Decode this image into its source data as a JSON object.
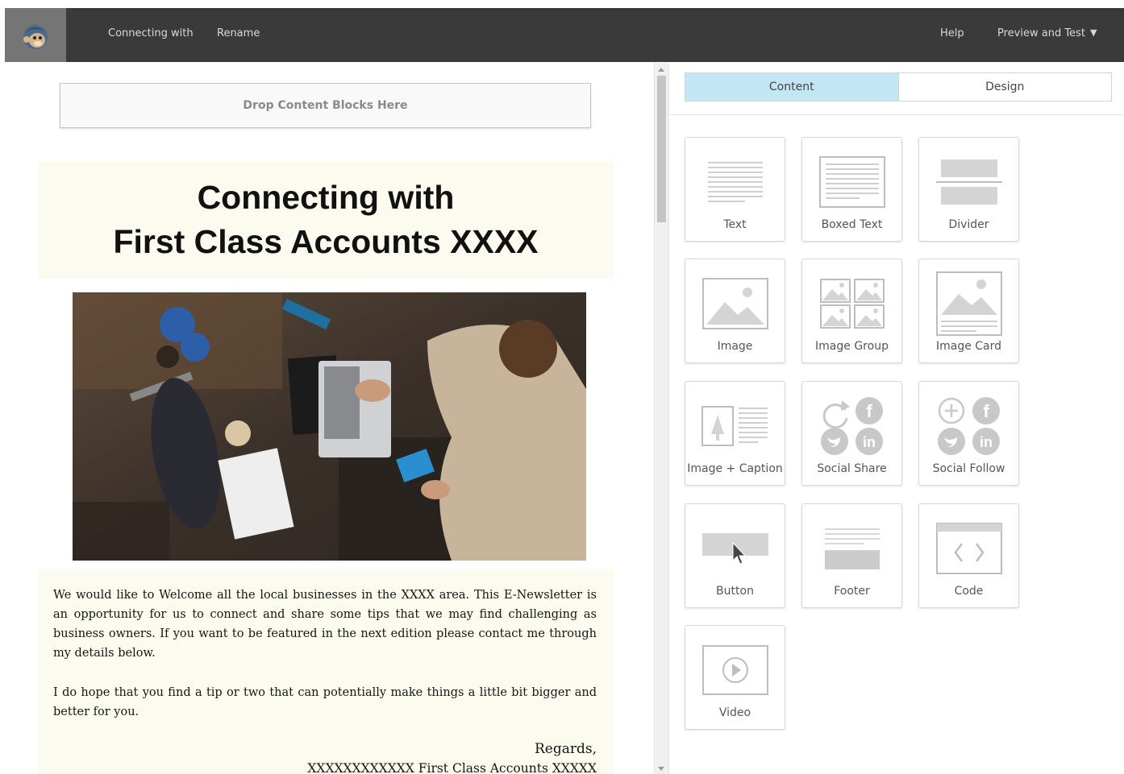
{
  "header": {
    "title_link": "Connecting with",
    "rename_link": "Rename",
    "help_link": "Help",
    "preview_link": "Preview and Test"
  },
  "editor": {
    "drop_zone_text": "Drop Content Blocks Here",
    "heading_line1": "Connecting with",
    "heading_line2": "First Class Accounts XXXX",
    "paragraph1": "We would like to Welcome all the local businesses in the XXXX area. This E-Newsletter is an opportunity for us to connect and share some tips that we may find challenging as business owners. If you want to be featured in the next edition please contact me through my details below.",
    "paragraph2": "I do hope that you find a tip or two that can potentially make things a little bit bigger and better for you.",
    "regards": "Regards,",
    "signature": "XXXXXXXXXXXX First Class Accounts XXXXX"
  },
  "panel": {
    "tabs": [
      "Content",
      "Design"
    ],
    "active_tab": "Content",
    "blocks": [
      {
        "label": "Text",
        "icon": "text-block-icon"
      },
      {
        "label": "Boxed Text",
        "icon": "boxed-text-block-icon"
      },
      {
        "label": "Divider",
        "icon": "divider-block-icon"
      },
      {
        "label": "Image",
        "icon": "image-block-icon"
      },
      {
        "label": "Image Group",
        "icon": "image-group-block-icon"
      },
      {
        "label": "Image Card",
        "icon": "image-card-block-icon"
      },
      {
        "label": "Image + Caption",
        "icon": "image-caption-block-icon"
      },
      {
        "label": "Social Share",
        "icon": "social-share-block-icon"
      },
      {
        "label": "Social Follow",
        "icon": "social-follow-block-icon"
      },
      {
        "label": "Button",
        "icon": "button-block-icon"
      },
      {
        "label": "Footer",
        "icon": "footer-block-icon"
      },
      {
        "label": "Code",
        "icon": "code-block-icon"
      },
      {
        "label": "Video",
        "icon": "video-block-icon"
      }
    ]
  },
  "colors": {
    "topbar": "#3a3a3a",
    "active_tab": "#c2e6f4",
    "block_bg": "#fcfbef",
    "icon_gray": "#d4d4d4"
  }
}
